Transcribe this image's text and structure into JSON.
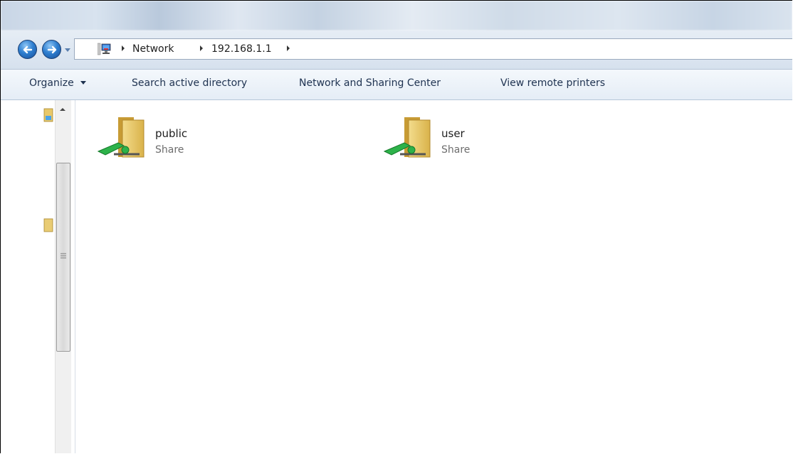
{
  "address": {
    "crumbs": [
      "Network",
      "192.168.1.1"
    ]
  },
  "toolbar": {
    "organize": "Organize",
    "search_ad": "Search active directory",
    "network_sharing": "Network and Sharing Center",
    "remote_printers": "View remote printers"
  },
  "items": [
    {
      "name": "public",
      "type": "Share"
    },
    {
      "name": "user",
      "type": "Share"
    }
  ],
  "icons": {
    "back": "back-arrow-icon",
    "forward": "forward-arrow-icon",
    "network": "network-location-icon",
    "share": "shared-folder-icon"
  },
  "colors": {
    "accent": "#2f7fd0",
    "toolbar_text": "#1e3250",
    "secondary_text": "#6d6d6d"
  }
}
